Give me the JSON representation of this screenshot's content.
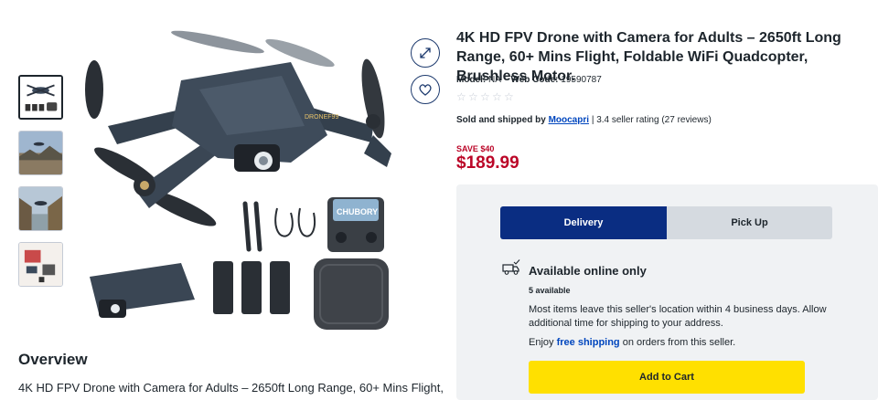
{
  "product": {
    "title": "4K HD FPV Drone with Camera for Adults – 2650ft Long Range, 60+ Mins Flight, Foldable WiFi Quadcopter, Brushless Motor.",
    "model_label": "Model:",
    "model_value": "NA",
    "webcode_label": "Web Code:",
    "webcode_value": "19590787",
    "rating_stars": 0,
    "seller_prefix": "Sold and shipped by",
    "seller_name": "Moocapri",
    "seller_rating": "| 3.4 seller rating (27 reviews)",
    "save_label": "SAVE $40",
    "price": "$189.99",
    "image_brand_text": "DRONEF99",
    "image_case_text": "CHUBORY"
  },
  "icons": {
    "expand": "expand-icon",
    "favorite": "heart-icon",
    "truck": "truck-icon",
    "star": "star-icon"
  },
  "thumbnails": [
    {
      "name": "thumbnail-1",
      "active": true
    },
    {
      "name": "thumbnail-2",
      "active": false
    },
    {
      "name": "thumbnail-3",
      "active": false
    },
    {
      "name": "thumbnail-4",
      "active": false
    }
  ],
  "fulfillment": {
    "delivery_label": "Delivery",
    "pickup_label": "Pick Up",
    "availability_title": "Available online only",
    "available_count": "5 available",
    "shipping_note": "Most items leave this seller's location within 4 business days. Allow additional time for shipping to your address.",
    "enjoy_prefix": "Enjoy",
    "free_shipping": "free shipping",
    "enjoy_suffix": "on orders from this seller.",
    "add_to_cart_label": "Add to Cart"
  },
  "overview": {
    "title": "Overview",
    "text": "4K HD FPV Drone with Camera for Adults – 2650ft Long Range, 60+ Mins Flight,"
  },
  "colors": {
    "delivery_bg": "#0a2d82",
    "price_red": "#bb0628",
    "link_blue": "#0046be",
    "cart_yellow": "#ffe000",
    "panel_bg": "#f0f2f4"
  }
}
